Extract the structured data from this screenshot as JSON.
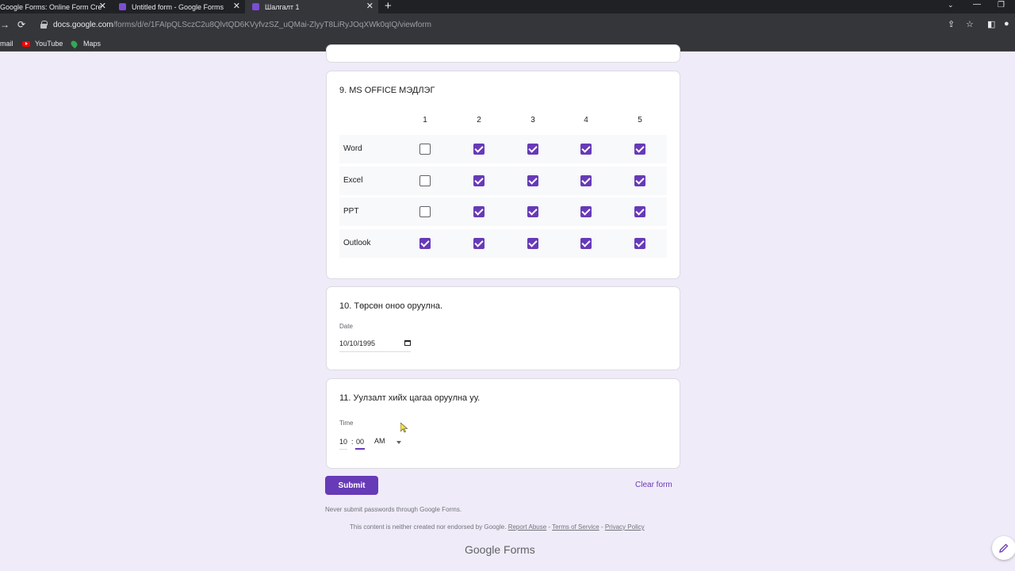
{
  "browser": {
    "tabs": [
      {
        "title": "Google Forms: Online Form Cre"
      },
      {
        "title": "Untitled form - Google Forms"
      },
      {
        "title": "Шалгалт 1"
      }
    ],
    "url_host": "docs.google.com",
    "url_path": "/forms/d/e/1FAIpQLSczC2u8QlvtQD6KVyfvzSZ_uQMai-ZlyyT8LiRyJOqXWk0qIQ/viewform",
    "bookmarks": [
      "mail",
      "YouTube",
      "Maps"
    ],
    "icons": {
      "new_tab": "+",
      "minimize": "—",
      "restore": "❐",
      "back": "←",
      "forward": "→",
      "reload": "⟳"
    }
  },
  "form": {
    "accent_color": "#673ab7",
    "q9": {
      "title": "9. MS OFFICE МЭДЛЭГ",
      "columns": [
        "1",
        "2",
        "3",
        "4",
        "5"
      ],
      "rows": [
        {
          "label": "Word",
          "checked": [
            false,
            true,
            true,
            true,
            true
          ]
        },
        {
          "label": "Excel",
          "checked": [
            false,
            true,
            true,
            true,
            true
          ]
        },
        {
          "label": "PPT",
          "checked": [
            false,
            true,
            true,
            true,
            true
          ]
        },
        {
          "label": "Outlook",
          "checked": [
            true,
            true,
            true,
            true,
            true
          ]
        }
      ]
    },
    "q10": {
      "title": "10. Төрсөн оноо оруулна.",
      "field_label": "Date",
      "value": "10/10/1995"
    },
    "q11": {
      "title": "11. Уулзалт хийх цагаа оруулна уу.",
      "field_label": "Time",
      "hour": "10",
      "separator": ":",
      "minute": "00",
      "ampm": "AM"
    },
    "submit_label": "Submit",
    "clear_label": "Clear form",
    "password_note": "Never submit passwords through Google Forms.",
    "footer": {
      "text": "This content is neither created nor endorsed by Google.",
      "report": "Report Abuse",
      "sep1": " - ",
      "terms": "Terms of Service",
      "sep2": " - ",
      "privacy": "Privacy Policy"
    },
    "brand_google": "Google",
    "brand_forms": "Forms"
  }
}
